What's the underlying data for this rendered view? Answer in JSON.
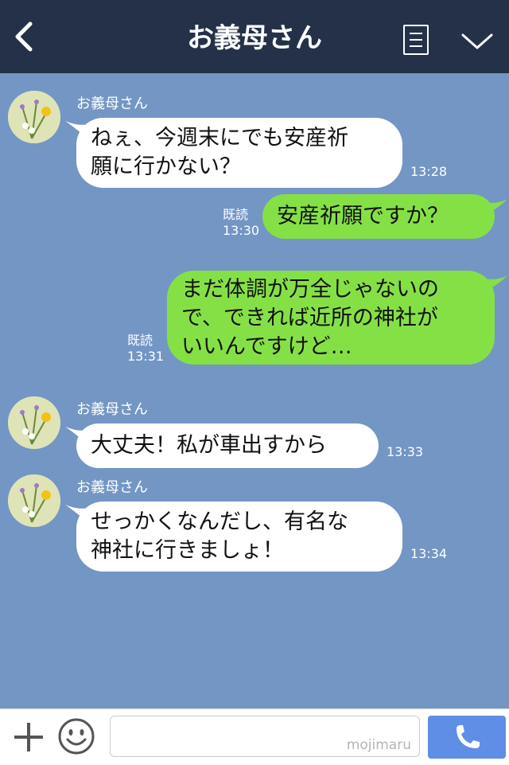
{
  "header": {
    "title": "お義母さん",
    "back_icon": "chevron-left-icon",
    "menu_icon": "menu-icon",
    "collapse_icon": "chevron-down-icon",
    "background": "#243148"
  },
  "chat": {
    "background": "#7396c4",
    "messages": [
      {
        "direction": "incoming",
        "sender": "お義母さん",
        "lines": [
          "ねぇ、今週末にでも安産祈",
          "願に行かない？"
        ],
        "time": "13:28"
      },
      {
        "direction": "outgoing",
        "lines": [
          "安産祈願ですか？"
        ],
        "read": "既読",
        "time": "13:30"
      },
      {
        "direction": "outgoing",
        "lines": [
          "まだ体調が万全じゃないの",
          "で、できれば近所の神社が",
          "いいんですけど…"
        ],
        "read": "既読",
        "time": "13:31"
      },
      {
        "direction": "incoming",
        "sender": "お義母さん",
        "lines": [
          "大丈夫！私が車出すから"
        ],
        "time": "13:33"
      },
      {
        "direction": "incoming",
        "sender": "お義母さん",
        "lines": [
          "せっかくなんだし、有名な",
          "神社に行きましょ！"
        ],
        "time": "13:34"
      }
    ]
  },
  "footer": {
    "add_icon": "plus-icon",
    "emoji_icon": "smiley-icon",
    "input_value": "",
    "watermark": "mojimaru",
    "call_icon": "phone-icon",
    "call_color": "#5f8ee6"
  }
}
